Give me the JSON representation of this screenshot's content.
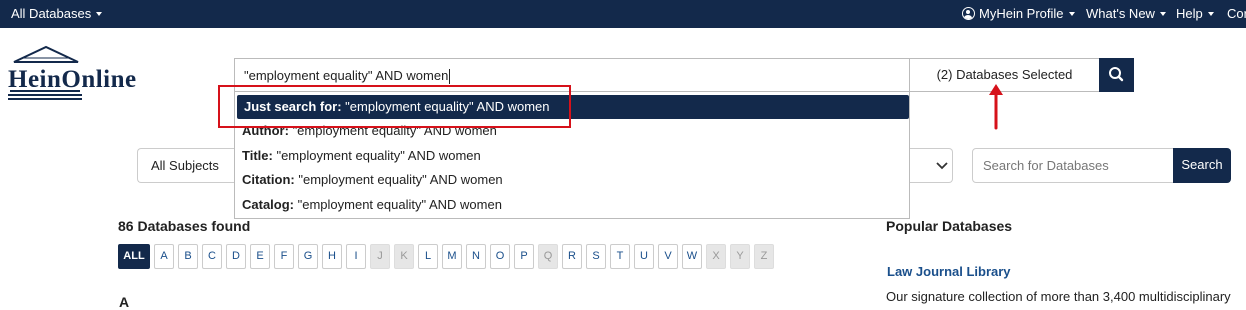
{
  "topbar": {
    "databases_menu": "All Databases",
    "profile": "MyHein Profile",
    "whats_new": "What's New",
    "help": "Help",
    "contact": "Cor"
  },
  "logo": {
    "text": "HeinOnline"
  },
  "search": {
    "value": "\"employment equality\" AND women",
    "databases_selected": "(2) Databases Selected"
  },
  "dropdown": {
    "items": [
      {
        "label": "Just search for:",
        "value": "\"employment equality\" AND women"
      },
      {
        "label": "Author:",
        "value": "\"employment equality\" AND women"
      },
      {
        "label": "Title:",
        "value": "\"employment equality\" AND women"
      },
      {
        "label": "Citation:",
        "value": "\"employment equality\" AND women"
      },
      {
        "label": "Catalog:",
        "value": "\"employment equality\" AND women"
      }
    ]
  },
  "filters": {
    "subject": "All Subjects",
    "db_search_placeholder": "Search for Databases",
    "db_search_button": "Search"
  },
  "results": {
    "found": "86 Databases found",
    "alphabet": [
      {
        "label": "ALL",
        "state": "active"
      },
      {
        "label": "A",
        "state": "enabled"
      },
      {
        "label": "B",
        "state": "enabled"
      },
      {
        "label": "C",
        "state": "enabled"
      },
      {
        "label": "D",
        "state": "enabled"
      },
      {
        "label": "E",
        "state": "enabled"
      },
      {
        "label": "F",
        "state": "enabled"
      },
      {
        "label": "G",
        "state": "enabled"
      },
      {
        "label": "H",
        "state": "enabled"
      },
      {
        "label": "I",
        "state": "enabled"
      },
      {
        "label": "J",
        "state": "disabled"
      },
      {
        "label": "K",
        "state": "disabled"
      },
      {
        "label": "L",
        "state": "enabled"
      },
      {
        "label": "M",
        "state": "enabled"
      },
      {
        "label": "N",
        "state": "enabled"
      },
      {
        "label": "O",
        "state": "enabled"
      },
      {
        "label": "P",
        "state": "enabled"
      },
      {
        "label": "Q",
        "state": "disabled"
      },
      {
        "label": "R",
        "state": "enabled"
      },
      {
        "label": "S",
        "state": "enabled"
      },
      {
        "label": "T",
        "state": "enabled"
      },
      {
        "label": "U",
        "state": "enabled"
      },
      {
        "label": "V",
        "state": "enabled"
      },
      {
        "label": "W",
        "state": "enabled"
      },
      {
        "label": "X",
        "state": "disabled"
      },
      {
        "label": "Y",
        "state": "disabled"
      },
      {
        "label": "Z",
        "state": "disabled"
      }
    ],
    "section_letter": "A"
  },
  "popular": {
    "title": "Popular Databases",
    "link": "Law Journal Library",
    "description": "Our signature collection of more than 3,400 multidisciplinary"
  },
  "colors": {
    "navy": "#13294b",
    "link": "#1a4f8b",
    "annotation_red": "#d6111a"
  }
}
